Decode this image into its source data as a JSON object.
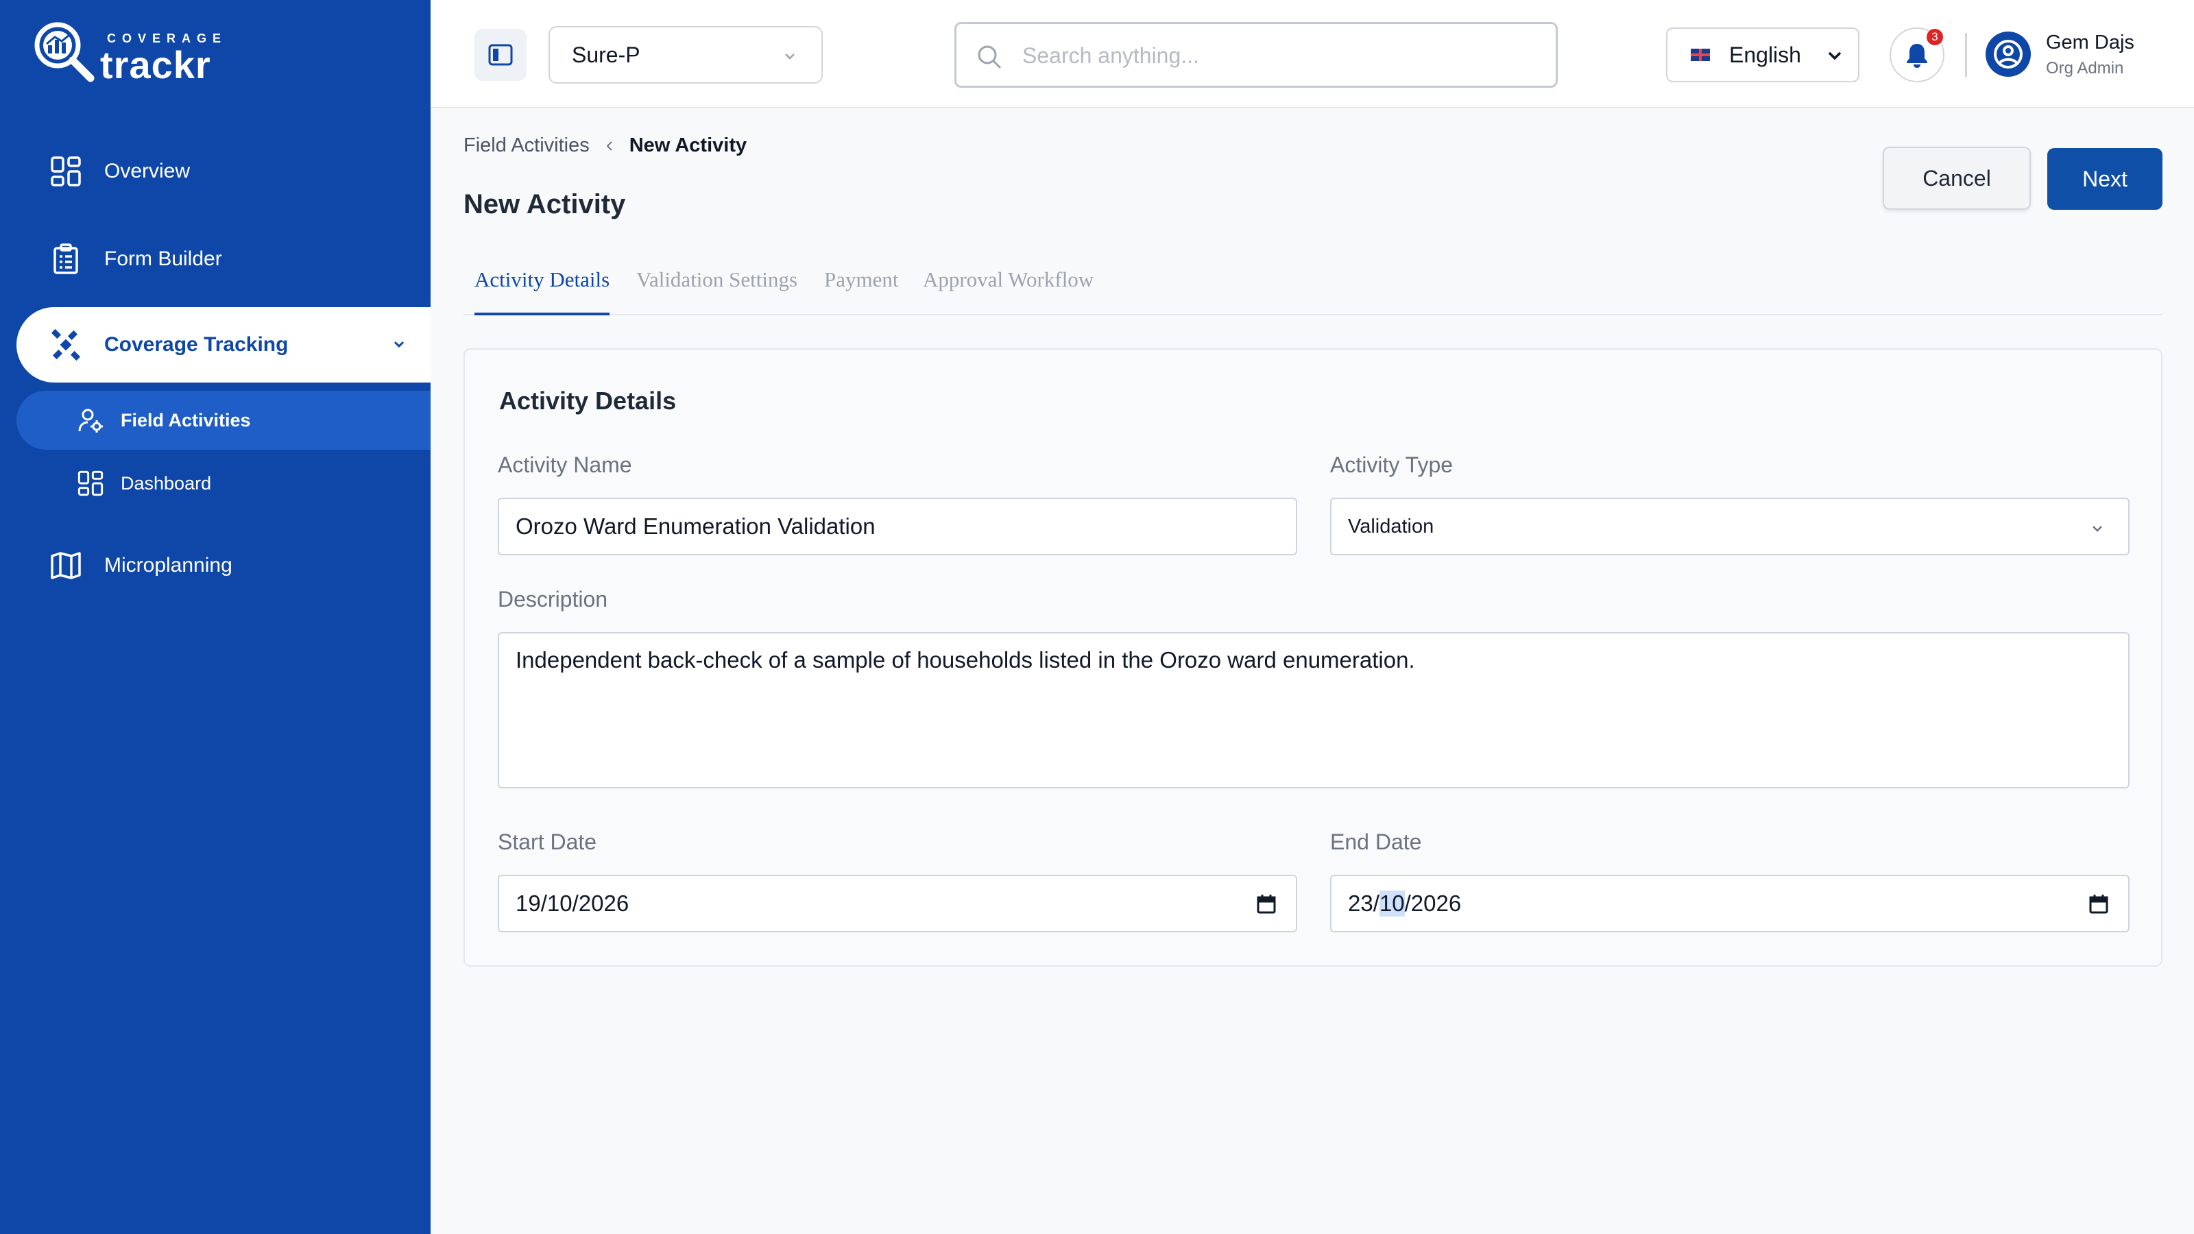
{
  "brand": {
    "small": "COVERAGE",
    "big": "trackr"
  },
  "sidebar": {
    "items": [
      {
        "label": "Overview",
        "icon": "grid-icon"
      },
      {
        "label": "Form Builder",
        "icon": "clipboard-icon"
      },
      {
        "label": "Coverage Tracking",
        "icon": "satellite-icon"
      },
      {
        "label": "Field Activities",
        "icon": "user-settings-icon"
      },
      {
        "label": "Dashboard",
        "icon": "grid-icon"
      },
      {
        "label": "Microplanning",
        "icon": "map-icon"
      }
    ]
  },
  "topbar": {
    "project": "Sure-P",
    "search_placeholder": "Search anything...",
    "language": "English",
    "notifications_count": "3",
    "user_name": "Gem Dajs",
    "user_role": "Org Admin"
  },
  "breadcrumb": {
    "parent": "Field Activities",
    "current": "New Activity"
  },
  "page": {
    "title": "New Activity",
    "cancel_label": "Cancel",
    "next_label": "Next"
  },
  "tabs": [
    {
      "label": "Activity Details",
      "active": true
    },
    {
      "label": "Validation Settings",
      "active": false
    },
    {
      "label": "Payment",
      "active": false
    },
    {
      "label": "Approval Workflow",
      "active": false
    }
  ],
  "form": {
    "section_title": "Activity Details",
    "activity_name_label": "Activity Name",
    "activity_name_value": "Orozo Ward Enumeration Validation",
    "activity_type_label": "Activity Type",
    "activity_type_value": "Validation",
    "description_label": "Description",
    "description_value": "Independent back-check of a sample of households listed in the Orozo ward enumeration.",
    "start_date_label": "Start Date",
    "start_date_day": "19",
    "start_date_month": "10",
    "start_date_year": "2026",
    "end_date_label": "End Date",
    "end_date_day": "23",
    "end_date_month": "10",
    "end_date_year": "2026"
  },
  "colors": {
    "brand_blue": "#0f47a8",
    "badge_red": "#dc2626"
  }
}
